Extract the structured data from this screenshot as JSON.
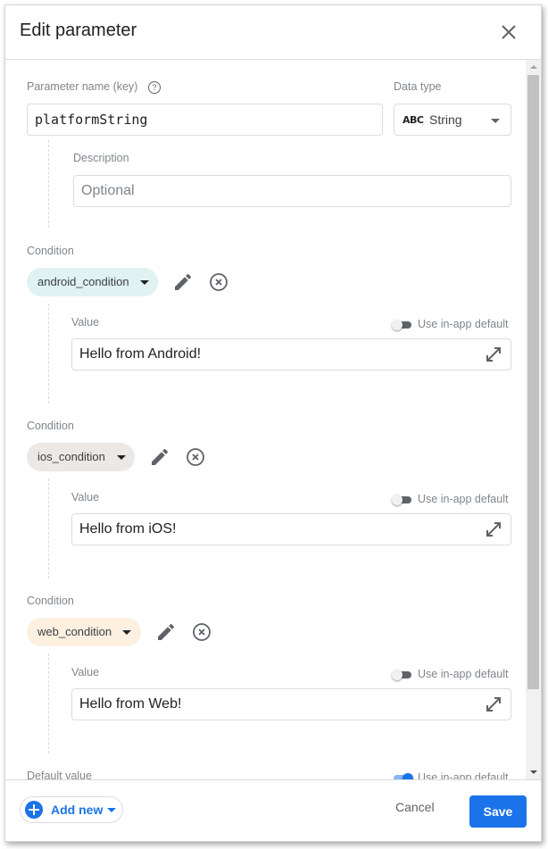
{
  "dialog": {
    "title": "Edit parameter",
    "close_icon": "close-icon"
  },
  "parameter": {
    "name_label": "Parameter name (key)",
    "help_icon": "help-circle-icon",
    "help_glyph": "?",
    "name_value": "platformString",
    "data_type_label": "Data type",
    "data_type_icon_text": "ABC",
    "data_type_value": "String",
    "description_label": "Description",
    "description_placeholder": "Optional"
  },
  "conditions": [
    {
      "label": "Condition",
      "chip": "android_condition",
      "chip_color": "#e0f2f1",
      "value_label": "Value",
      "toggle_label": "Use in-app default",
      "toggle_on": false,
      "value": "Hello from Android!"
    },
    {
      "label": "Condition",
      "chip": "ios_condition",
      "chip_color": "#ece8e6",
      "value_label": "Value",
      "toggle_label": "Use in-app default",
      "toggle_on": false,
      "value": "Hello from iOS!"
    },
    {
      "label": "Condition",
      "chip": "web_condition",
      "chip_color": "#fdf0e1",
      "value_label": "Value",
      "toggle_label": "Use in-app default",
      "toggle_on": false,
      "value": "Hello from Web!"
    }
  ],
  "default_value": {
    "label": "Default value",
    "toggle_label": "Use in-app default",
    "toggle_on": true
  },
  "footer": {
    "add_new_label": "Add new",
    "cancel_label": "Cancel",
    "save_label": "Save"
  },
  "colors": {
    "accent": "#1a73e8",
    "text_primary": "#202124",
    "text_secondary": "#80868b",
    "border": "#dadce0"
  }
}
